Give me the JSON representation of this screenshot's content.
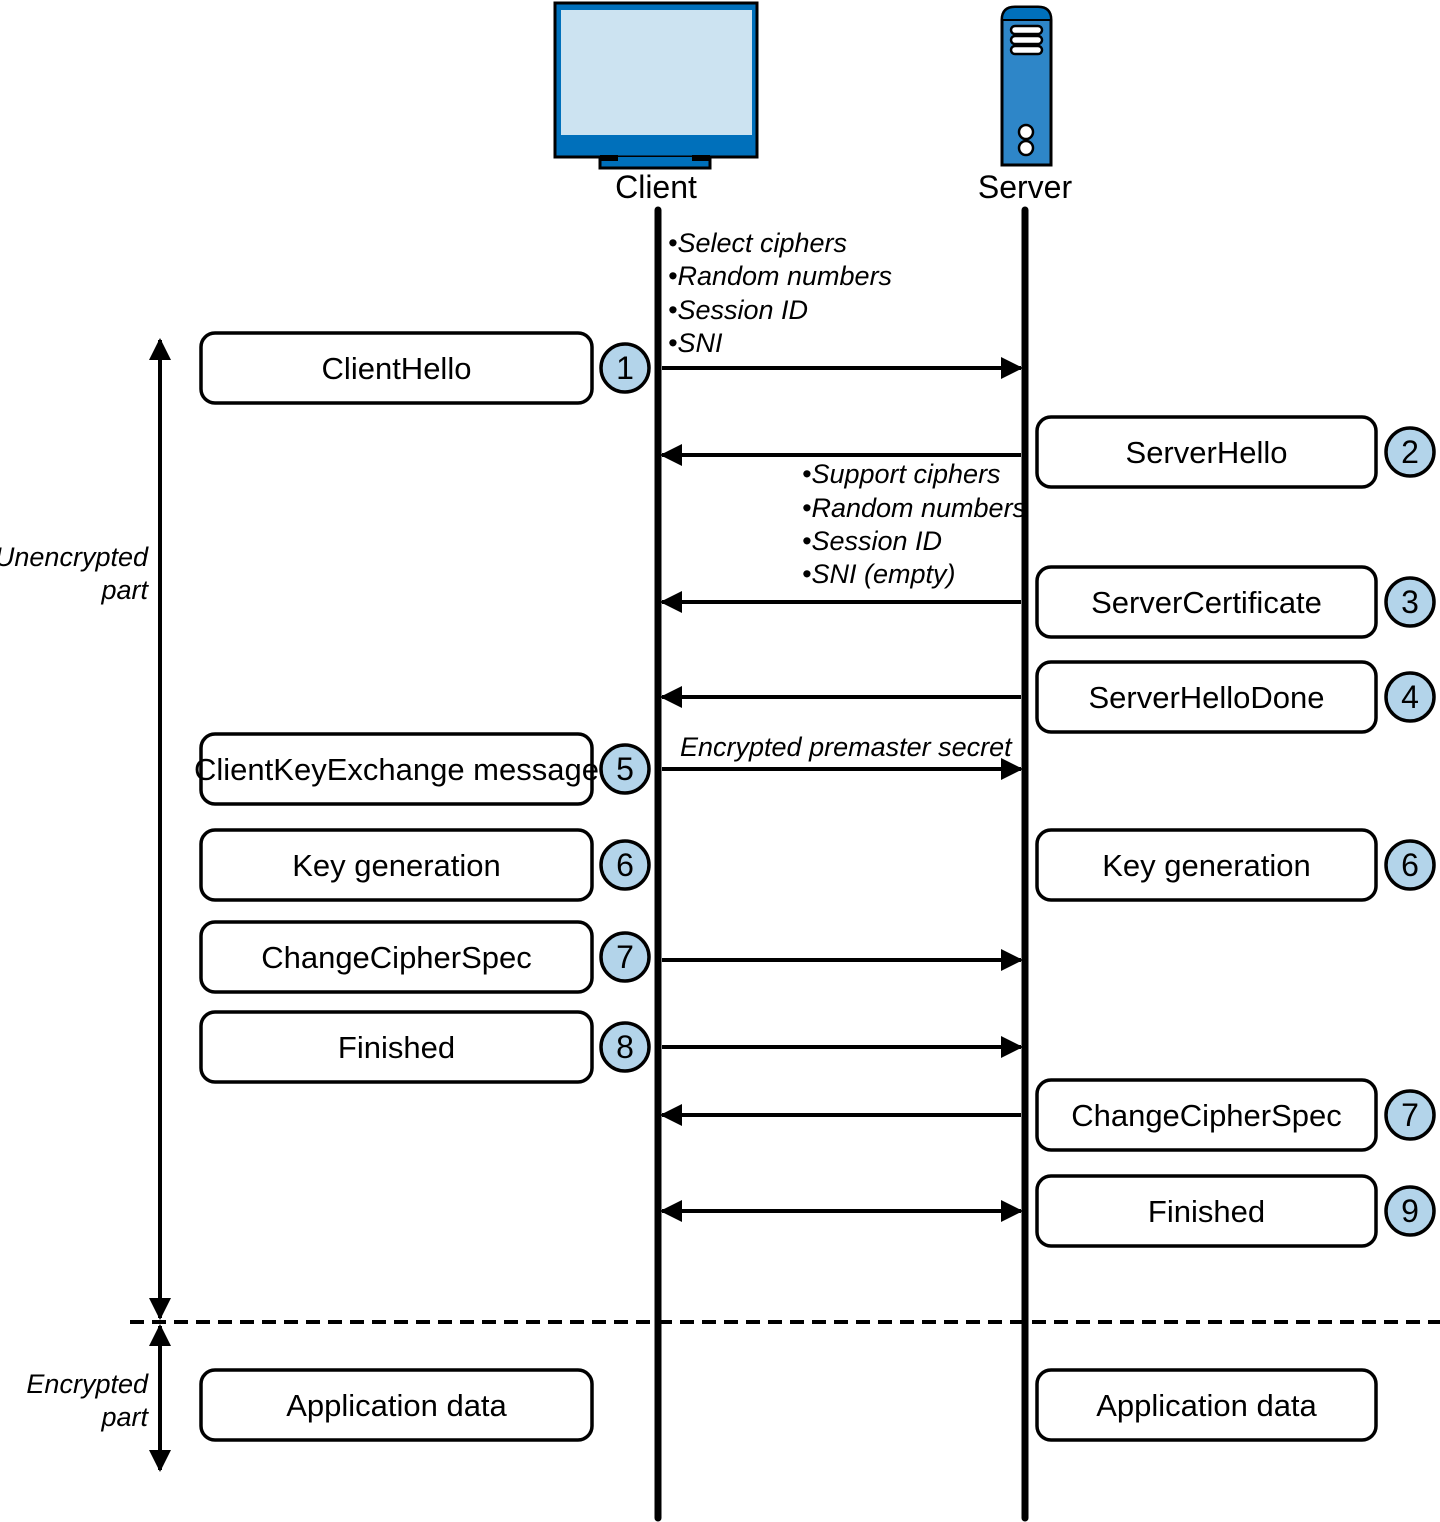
{
  "actors": {
    "client": {
      "label": "Client",
      "icon": "computer-monitor-icon"
    },
    "server": {
      "label": "Server",
      "icon": "server-tower-icon"
    }
  },
  "colors": {
    "monitor_screen": "#cce3f1",
    "monitor_frame": "#0070bb",
    "server_body": "#2e86c8",
    "server_top": "#0070bb",
    "step_badge": "#b3d4ea",
    "line": "#000000"
  },
  "client_hello_notes": [
    "•Select ciphers",
    "•Random numbers",
    "•Session ID",
    "•SNI"
  ],
  "server_hello_notes": [
    "•Support ciphers",
    "•Random numbers",
    "•Session ID",
    "•SNI (empty)"
  ],
  "premaster_note": "Encrypted premaster secret",
  "phases": {
    "unencrypted": [
      "Unencrypted",
      "part"
    ],
    "encrypted": [
      "Encrypted",
      "part"
    ]
  },
  "steps": [
    {
      "side": "client",
      "label": "ClientHello",
      "number": "1",
      "arrow": "to-server"
    },
    {
      "side": "server",
      "label": "ServerHello",
      "number": "2",
      "arrow": "to-client"
    },
    {
      "side": "server",
      "label": "ServerCertificate",
      "number": "3",
      "arrow": "to-client"
    },
    {
      "side": "server",
      "label": "ServerHelloDone",
      "number": "4",
      "arrow": "to-client"
    },
    {
      "side": "client",
      "label": "ClientKeyExchange message",
      "number": "5",
      "arrow": "to-server"
    },
    {
      "side": "client",
      "label": "Key generation",
      "number": "6",
      "arrow": "none"
    },
    {
      "side": "server",
      "label": "Key generation",
      "number": "6",
      "arrow": "none"
    },
    {
      "side": "client",
      "label": "ChangeCipherSpec",
      "number": "7",
      "arrow": "to-server"
    },
    {
      "side": "client",
      "label": "Finished",
      "number": "8",
      "arrow": "to-server"
    },
    {
      "side": "server",
      "label": "ChangeCipherSpec",
      "number": "7",
      "arrow": "to-client"
    },
    {
      "side": "server",
      "label": "Finished",
      "number": "9",
      "arrow": "both"
    },
    {
      "side": "client",
      "label": "Application data",
      "number": "",
      "arrow": "none"
    },
    {
      "side": "server",
      "label": "Application data",
      "number": "",
      "arrow": "none"
    }
  ]
}
